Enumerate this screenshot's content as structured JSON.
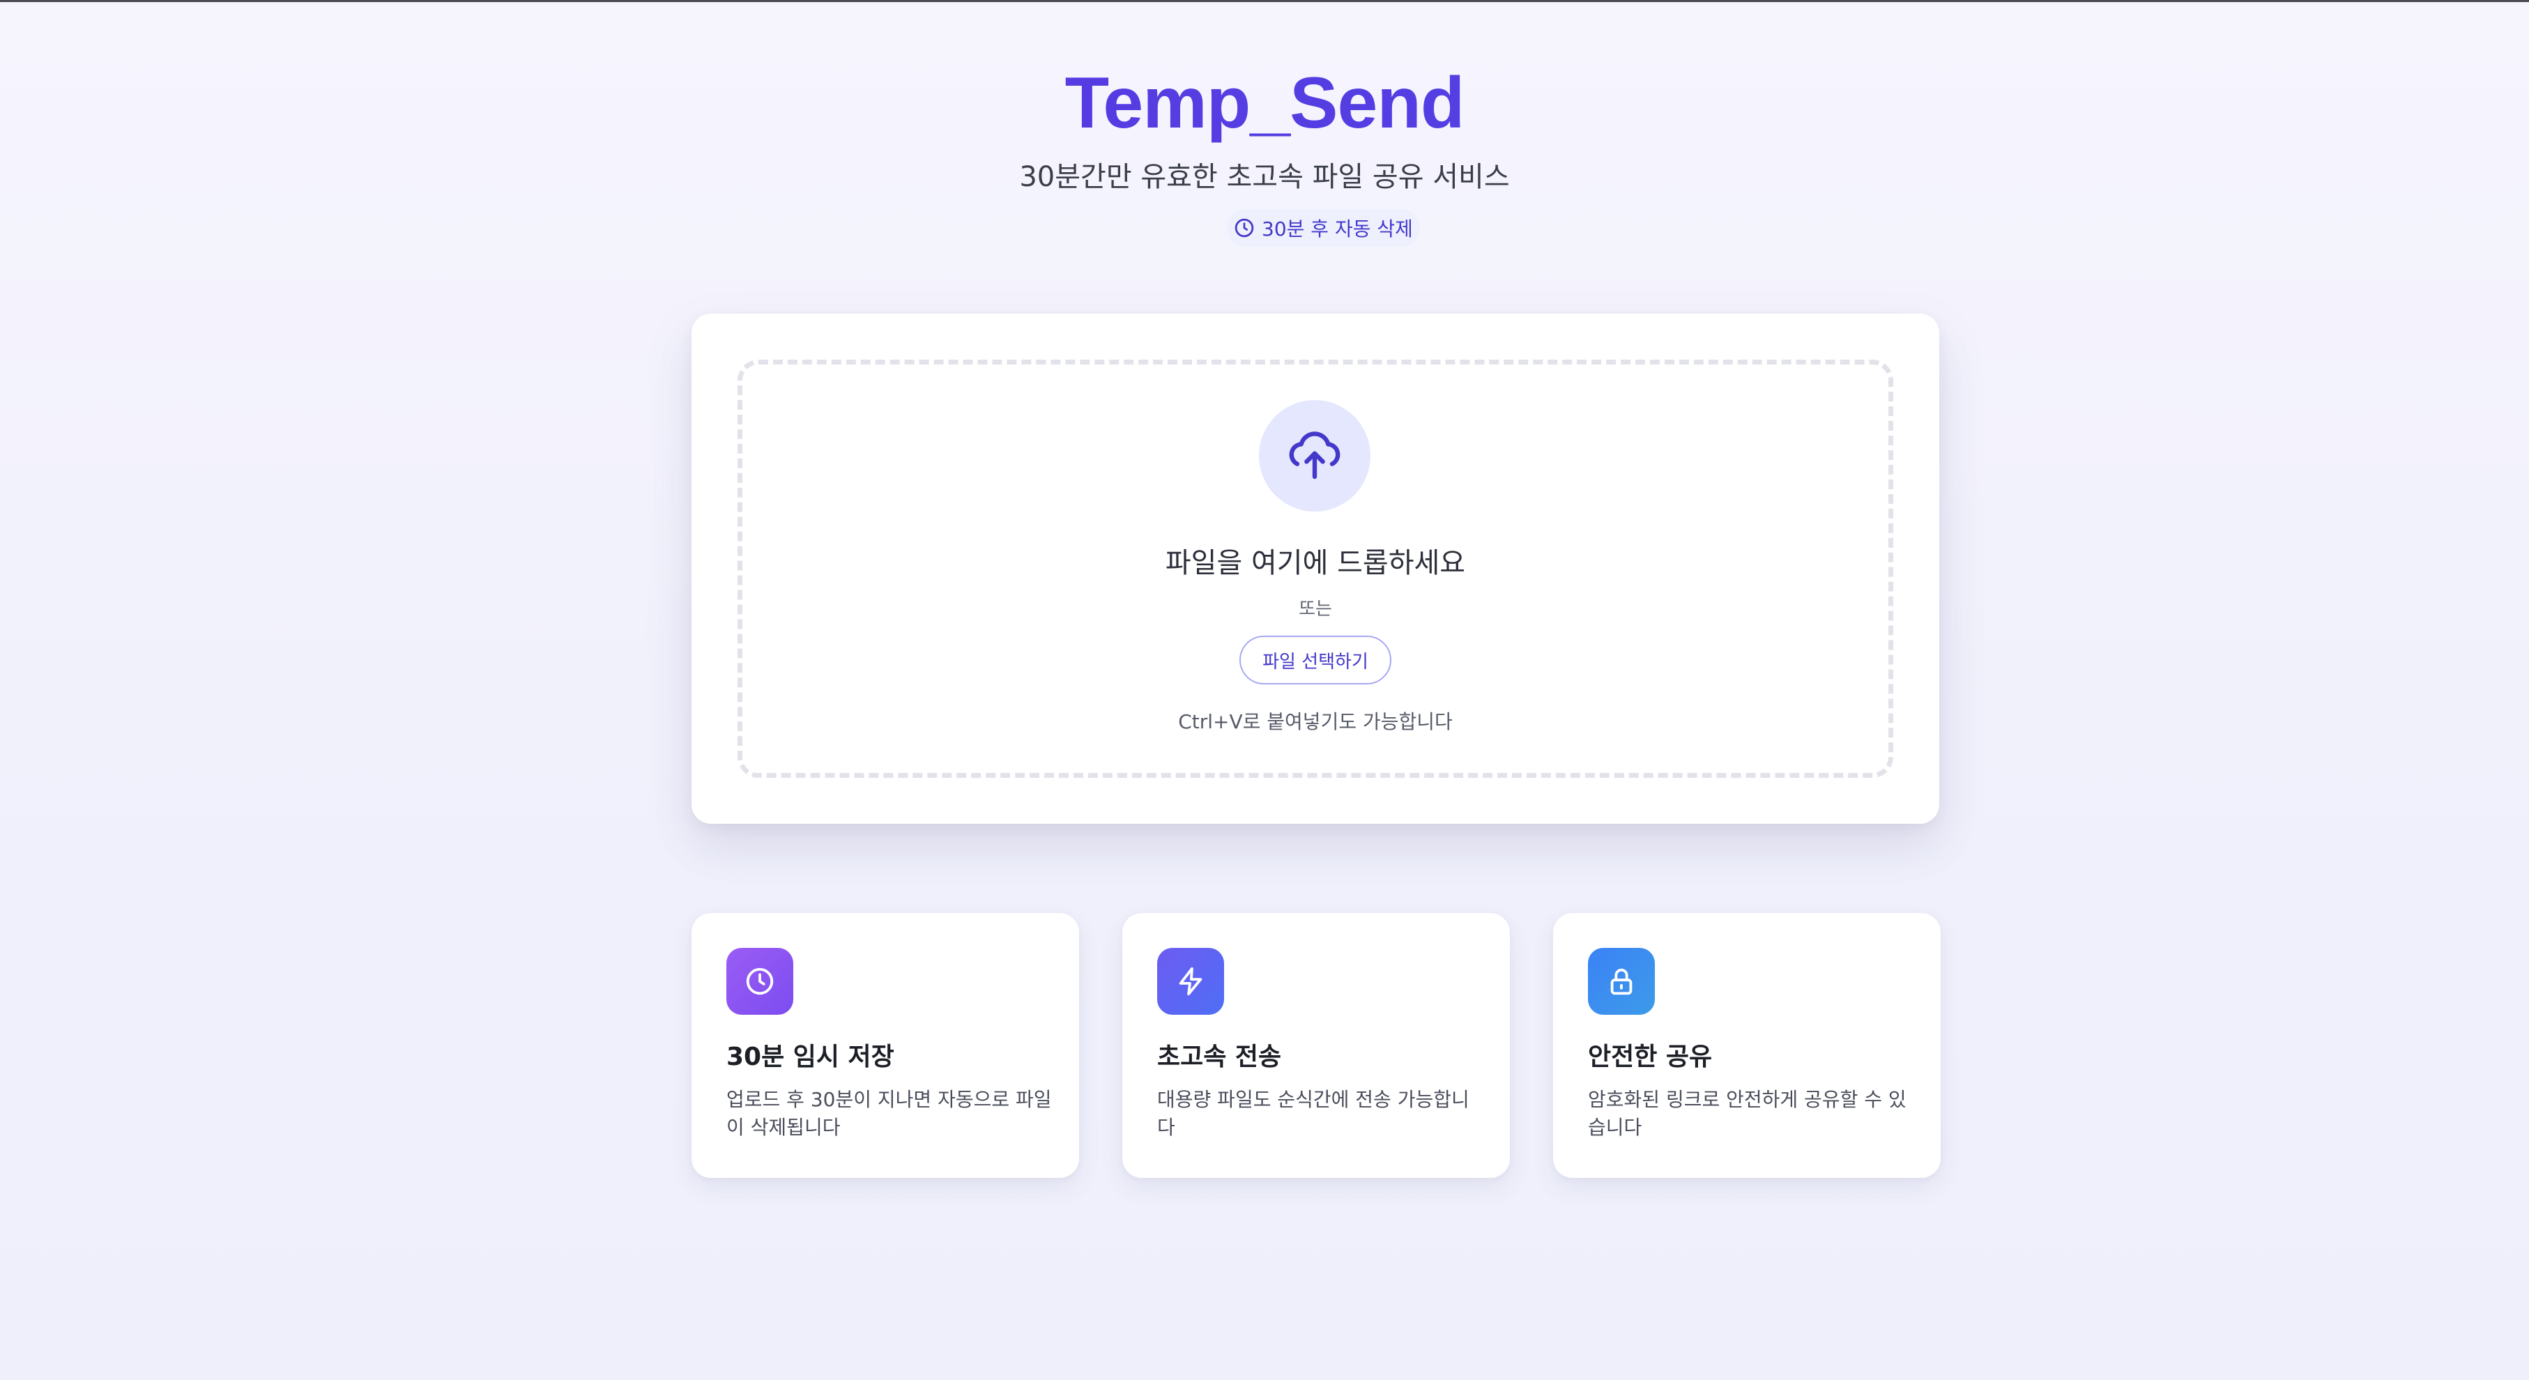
{
  "header": {
    "title": "Temp_Send",
    "subtitle": "30분간만 유효한 초고속 파일 공유 서비스",
    "badge": "30분 후 자동 삭제"
  },
  "upload": {
    "drop_title": "파일을 여기에 드롭하세요",
    "or_text": "또는",
    "select_button": "파일 선택하기",
    "paste_hint": "Ctrl+V로 붙여넣기도 가능합니다"
  },
  "features": [
    {
      "icon": "clock-icon",
      "title": "30분 임시 저장",
      "description": "업로드 후 30분이 지나면 자동으로 파일이 삭제됩니다"
    },
    {
      "icon": "lightning-icon",
      "title": "초고속 전송",
      "description": "대용량 파일도 순식간에 전송 가능합니다"
    },
    {
      "icon": "lock-icon",
      "title": "안전한 공유",
      "description": "암호화된 링크로 안전하게 공유할 수 있습니다"
    }
  ],
  "colors": {
    "brand": "#5b3be2",
    "accent": "#4338ca",
    "upload_icon_bg": "#e4e7fd",
    "feature_purple": "#8b55f3",
    "feature_indigo": "#5b66f4",
    "feature_blue": "#3b8ef0"
  }
}
